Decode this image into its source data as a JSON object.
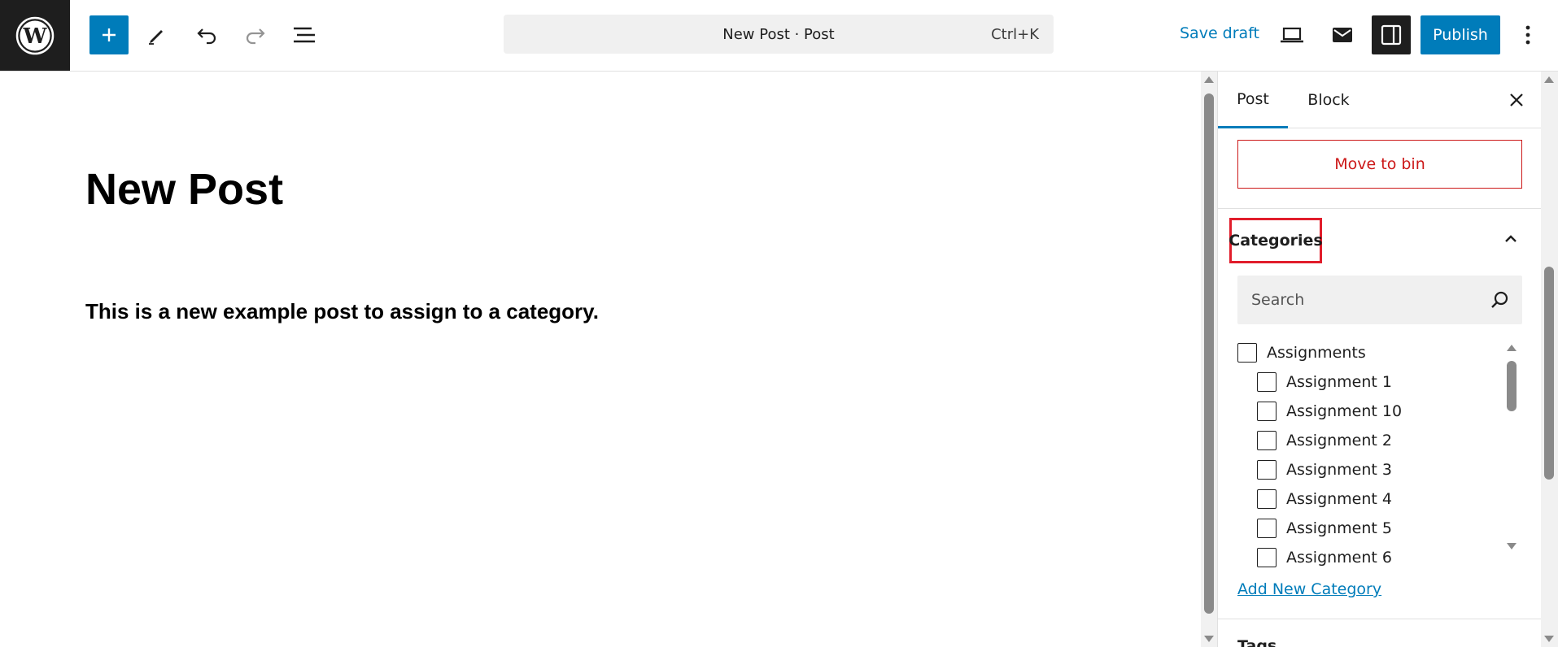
{
  "toolbar": {
    "document_title": "New Post · Post",
    "shortcut": "Ctrl+K",
    "save_draft_label": "Save draft",
    "publish_label": "Publish"
  },
  "editor": {
    "post_title": "New Post",
    "paragraph": "This is a new example post to assign to a category."
  },
  "sidebar": {
    "tabs": [
      {
        "label": "Post",
        "active": true
      },
      {
        "label": "Block",
        "active": false
      }
    ],
    "move_to_bin_label": "Move to bin",
    "categories": {
      "heading": "Categories",
      "expanded": true,
      "search_placeholder": "Search",
      "items": [
        {
          "label": "Assignments",
          "level": 0,
          "checked": false
        },
        {
          "label": "Assignment 1",
          "level": 1,
          "checked": false
        },
        {
          "label": "Assignment 10",
          "level": 1,
          "checked": false
        },
        {
          "label": "Assignment 2",
          "level": 1,
          "checked": false
        },
        {
          "label": "Assignment 3",
          "level": 1,
          "checked": false
        },
        {
          "label": "Assignment 4",
          "level": 1,
          "checked": false
        },
        {
          "label": "Assignment 5",
          "level": 1,
          "checked": false
        },
        {
          "label": "Assignment 6",
          "level": 1,
          "checked": false
        }
      ],
      "add_new_label": "Add New Category"
    },
    "next_panel_heading": "Tags"
  },
  "colors": {
    "accent": "#007cba",
    "danger": "#cc1818",
    "highlight_box": "#e11d2b",
    "dark": "#1e1e1e"
  }
}
